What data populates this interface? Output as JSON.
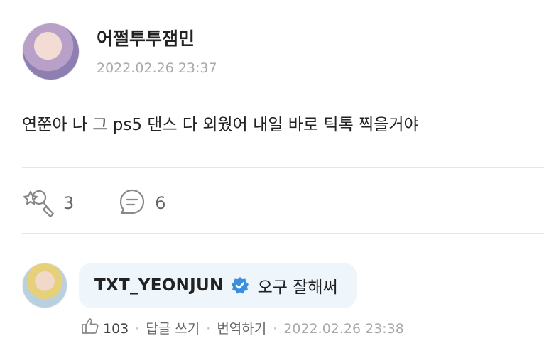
{
  "post": {
    "author": "어쩔투투잼민",
    "date": "2022.02.26 23:37",
    "body": "연쭌아 나 그 ps5 댄스 다 외웠어 내일 바로 틱톡 찍을거야",
    "reactions_count": "3",
    "comments_count": "6"
  },
  "comment": {
    "author": "TXT_YEONJUN",
    "text": "오구 잘해써",
    "likes": "103",
    "reply_label": "답글 쓰기",
    "translate_label": "번역하기",
    "date": "2022.02.26 23:38",
    "separator": "·"
  },
  "colors": {
    "verified_badge": "#3b8fe0",
    "bubble_bg": "#eef5fb",
    "muted_text": "#a9a9a9"
  },
  "icons": {
    "reaction": "cheer-stick-icon",
    "comments": "speech-bubble-icon",
    "verified": "verified-badge-icon",
    "like": "thumbs-up-icon"
  }
}
